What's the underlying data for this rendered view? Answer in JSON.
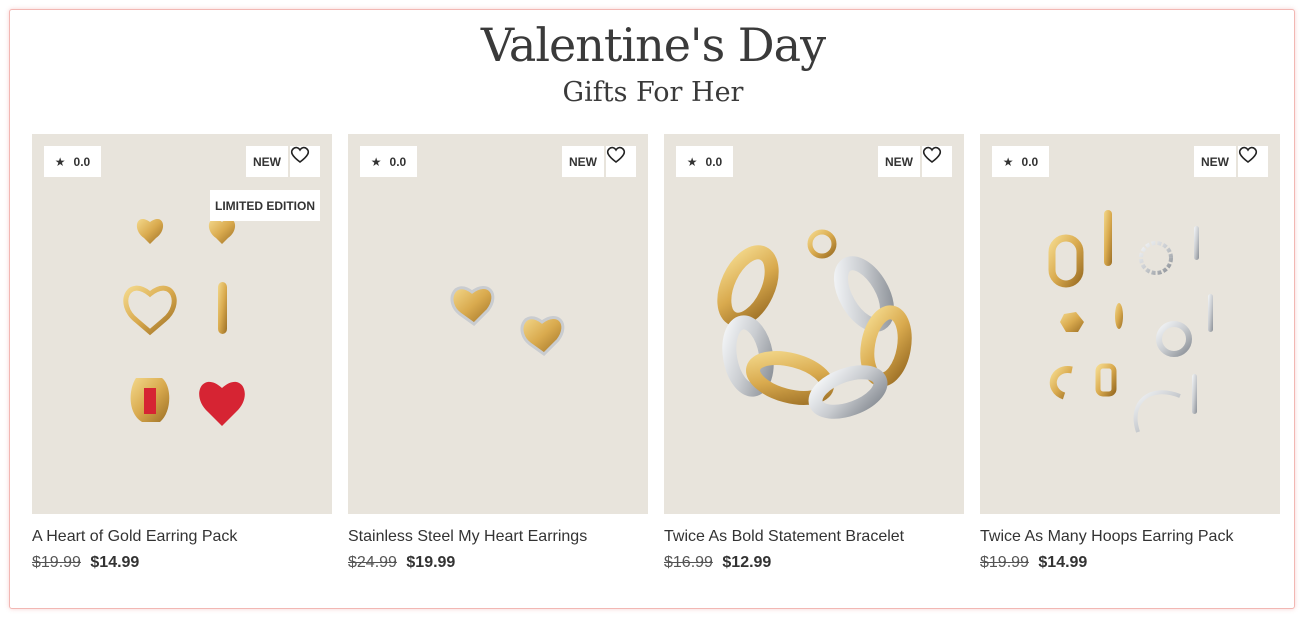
{
  "header": {
    "title": "Valentine's Day",
    "subtitle": "Gifts For Her"
  },
  "products": [
    {
      "rating": "0.0",
      "badge": "NEW",
      "extra_badge": "LIMITED EDITION",
      "name": "A Heart of Gold Earring Pack",
      "old_price": "$19.99",
      "price": "$14.99"
    },
    {
      "rating": "0.0",
      "badge": "NEW",
      "name": "Stainless Steel My Heart Earrings",
      "old_price": "$24.99",
      "price": "$19.99"
    },
    {
      "rating": "0.0",
      "badge": "NEW",
      "name": "Twice As Bold Statement Bracelet",
      "old_price": "$16.99",
      "price": "$12.99"
    },
    {
      "rating": "0.0",
      "badge": "NEW",
      "name": "Twice As Many Hoops Earring Pack",
      "old_price": "$19.99",
      "price": "$14.99"
    }
  ],
  "icons": {
    "rating": "star-icon",
    "wishlist": "heart-outline-icon"
  },
  "colors": {
    "frame_border": "#f2b7b3",
    "image_background": "#e8e4dc",
    "gold": "#d9aa4e",
    "silver": "#c9ccd0",
    "red": "#d62433"
  }
}
